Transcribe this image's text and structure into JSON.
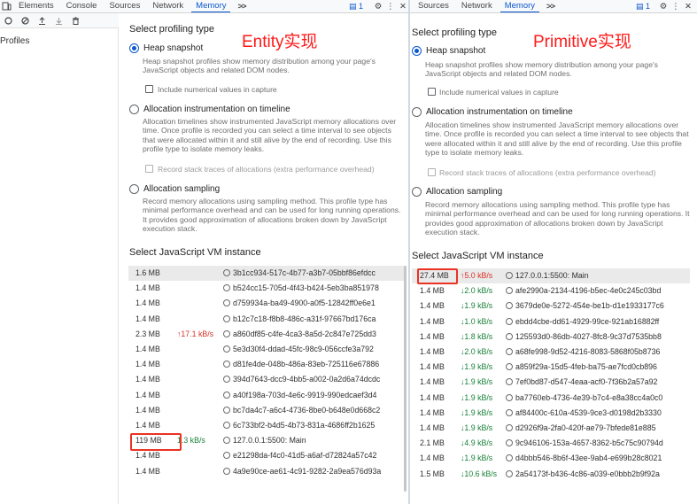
{
  "left_toolbar": {
    "tabs": [
      "Elements",
      "Console",
      "Sources",
      "Network",
      "Memory"
    ],
    "active_tab": "Memory",
    "more": ">>",
    "issues_count": "1"
  },
  "right_toolbar": {
    "tabs": [
      "Sources",
      "Network",
      "Memory"
    ],
    "active_tab": "Memory",
    "more": ">>",
    "issues_count": "1"
  },
  "sidebar": {
    "item": "Profiles"
  },
  "left_panel": {
    "overlay_label": "Entity实现",
    "select_profiling_type": "Select profiling type",
    "heap_snapshot": "Heap snapshot",
    "heap_desc": "Heap snapshot profiles show memory distribution among your page's JavaScript objects and related DOM nodes.",
    "include_numerical": "Include numerical values in capture",
    "alloc_timeline": "Allocation instrumentation on timeline",
    "alloc_timeline_desc": "Allocation timelines show instrumented JavaScript memory allocations over time. Once profile is recorded you can select a time interval to see objects that were allocated within it and still alive by the end of recording. Use this profile type to isolate memory leaks.",
    "record_stack": "Record stack traces of allocations (extra performance overhead)",
    "alloc_sampling": "Allocation sampling",
    "alloc_sampling_desc": "Record memory allocations using sampling method. This profile type has minimal performance overhead and can be used for long running operations. It provides good approximation of allocations broken down by JavaScript execution stack.",
    "select_vm": "Select JavaScript VM instance",
    "vm_rows": [
      {
        "size": "1.6 MB",
        "rate": "",
        "id": "3b1cc934-517c-4b77-a3b7-05bbf86efdcc"
      },
      {
        "size": "1.4 MB",
        "rate": "",
        "id": "b524cc15-705d-4f43-b424-5eb3ba851978"
      },
      {
        "size": "1.4 MB",
        "rate": "",
        "id": "d759934a-ba49-4900-a0f5-12842ff0e6e1"
      },
      {
        "size": "1.4 MB",
        "rate": "",
        "id": "b12c7c18-f8b8-486c-a31f-97667bd176ca"
      },
      {
        "size": "2.3 MB",
        "rate": "↑17.1 kB/s",
        "id": "a860df85-c4fe-4ca3-8a5d-2c847e725dd3"
      },
      {
        "size": "1.4 MB",
        "rate": "",
        "id": "5e3d30f4-ddad-45fc-98c9-056ccfe3a792"
      },
      {
        "size": "1.4 MB",
        "rate": "",
        "id": "d81fe4de-048b-486a-83eb-725116e67886"
      },
      {
        "size": "1.4 MB",
        "rate": "",
        "id": "394d7643-dcc9-4bb5-a002-0a2d6a74dcdc"
      },
      {
        "size": "1.4 MB",
        "rate": "",
        "id": "a40f198a-703d-4e6c-9919-990edcaef3d4"
      },
      {
        "size": "1.4 MB",
        "rate": "",
        "id": "bc7da4c7-a6c4-4736-8be0-b648e0d668c2"
      },
      {
        "size": "1.4 MB",
        "rate": "",
        "id": "6c733bf2-b4d5-4b73-831a-4686ff2b1625"
      },
      {
        "size": "119 MB",
        "rate": "1.3 kB/s",
        "id": "127.0.0.1:5500: Main"
      },
      {
        "size": "1.4 MB",
        "rate": "",
        "id": "e21298da-f4c0-41d5-a6af-d72824a57c42"
      },
      {
        "size": "1.4 MB",
        "rate": "",
        "id": "4a9e90ce-ae61-4c91-9282-2a9ea576d93a"
      }
    ]
  },
  "right_panel": {
    "overlay_label": "Primitive实现",
    "select_profiling_type": "Select profiling type",
    "heap_snapshot": "Heap snapshot",
    "heap_desc": "Heap snapshot profiles show memory distribution among your page's JavaScript objects and related DOM nodes.",
    "include_numerical": "Include numerical values in capture",
    "alloc_timeline": "Allocation instrumentation on timeline",
    "alloc_timeline_desc": "Allocation timelines show instrumented JavaScript memory allocations over time. Once profile is recorded you can select a time interval to see objects that were allocated within it and still alive by the end of recording. Use this profile type to isolate memory leaks.",
    "record_stack": "Record stack traces of allocations (extra performance overhead)",
    "alloc_sampling": "Allocation sampling",
    "alloc_sampling_desc": "Record memory allocations using sampling method. This profile type has minimal performance overhead and can be used for long running operations. It provides good approximation of allocations broken down by JavaScript execution stack.",
    "select_vm": "Select JavaScript VM instance",
    "vm_rows": [
      {
        "size": "27.4 MB",
        "rate": "↑5.0 kB/s",
        "id": "127.0.0.1:5500: Main"
      },
      {
        "size": "1.4 MB",
        "rate": "↓2.0 kB/s",
        "id": "afe2990a-2134-4196-b5ec-4e0c245c03bd"
      },
      {
        "size": "1.4 MB",
        "rate": "↓1.9 kB/s",
        "id": "3679de0e-5272-454e-be1b-d1e1933177c6"
      },
      {
        "size": "1.4 MB",
        "rate": "↓1.0 kB/s",
        "id": "ebdd4cbe-dd61-4929-99ce-921ab16882ff"
      },
      {
        "size": "1.4 MB",
        "rate": "↓1.8 kB/s",
        "id": "125593d0-86db-4027-8fc8-9c37d7535bb8"
      },
      {
        "size": "1.4 MB",
        "rate": "↓2.0 kB/s",
        "id": "a68fe998-9d52-4216-8083-5868f05b8736"
      },
      {
        "size": "1.4 MB",
        "rate": "↓1.9 kB/s",
        "id": "a859f29a-15d5-4feb-ba75-ae7fcd0cb896"
      },
      {
        "size": "1.4 MB",
        "rate": "↓1.9 kB/s",
        "id": "7ef0bd87-d547-4eaa-acf0-7f36b2a57a92"
      },
      {
        "size": "1.4 MB",
        "rate": "↓1.9 kB/s",
        "id": "ba7760eb-4736-4e39-b7c4-e8a38cc4a0c0"
      },
      {
        "size": "1.4 MB",
        "rate": "↓1.9 kB/s",
        "id": "af84400c-610a-4539-9ce3-d0198d2b3330"
      },
      {
        "size": "1.4 MB",
        "rate": "↓1.9 kB/s",
        "id": "d2926f9a-2fa0-420f-ae79-7bfede81e885"
      },
      {
        "size": "2.1 MB",
        "rate": "↓4.9 kB/s",
        "id": "9c946106-153a-4657-8362-b5c75c90794d"
      },
      {
        "size": "1.4 MB",
        "rate": "↓1.9 kB/s",
        "id": "d4bbb546-8b6f-43ee-9ab4-e699b28c8021"
      },
      {
        "size": "1.5 MB",
        "rate": "↓10.6 kB/s",
        "id": "2a54173f-b436-4c86-a039-e0bbb2b9f92a"
      }
    ]
  }
}
